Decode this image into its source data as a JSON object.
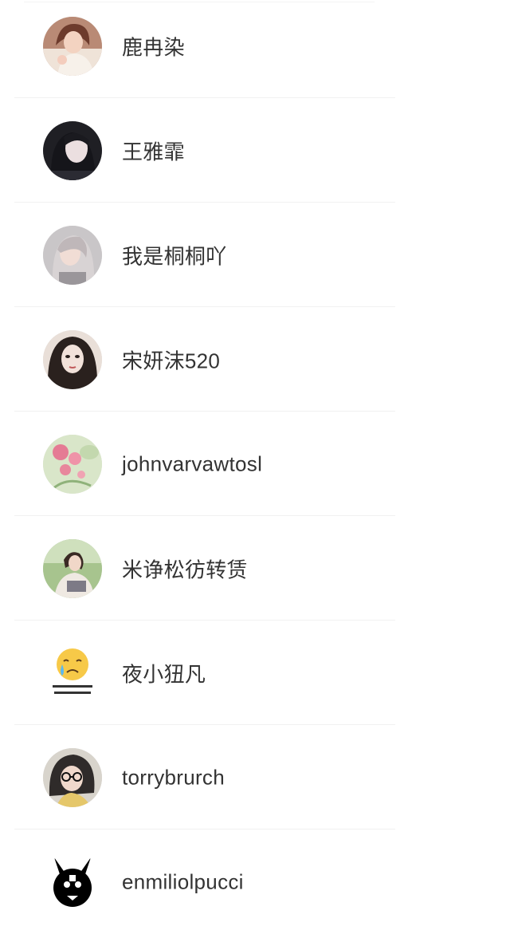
{
  "contacts": [
    {
      "name": "鹿冉染",
      "avatar_icon": "avatar-photo-girl-sofa"
    },
    {
      "name": "王雅霏",
      "avatar_icon": "avatar-photo-dark-hair"
    },
    {
      "name": "我是桐桐吖",
      "avatar_icon": "avatar-photo-light-hair"
    },
    {
      "name": "宋妍沫520",
      "avatar_icon": "avatar-illustration-portrait"
    },
    {
      "name": "johnvarvawtosl",
      "avatar_icon": "avatar-photo-pink-flowers"
    },
    {
      "name": "米诤松彷转赁",
      "avatar_icon": "avatar-photo-girl-outdoor"
    },
    {
      "name": "夜小狃凡",
      "avatar_icon": "avatar-crying-emoji"
    },
    {
      "name": "torrybrurch",
      "avatar_icon": "avatar-photo-glasses"
    },
    {
      "name": "enmiliolpucci",
      "avatar_icon": "avatar-skull-rabbit-logo"
    }
  ],
  "colors": {
    "background": "#ffffff",
    "name_text": "#333333",
    "divider": "#f1f1f1"
  }
}
